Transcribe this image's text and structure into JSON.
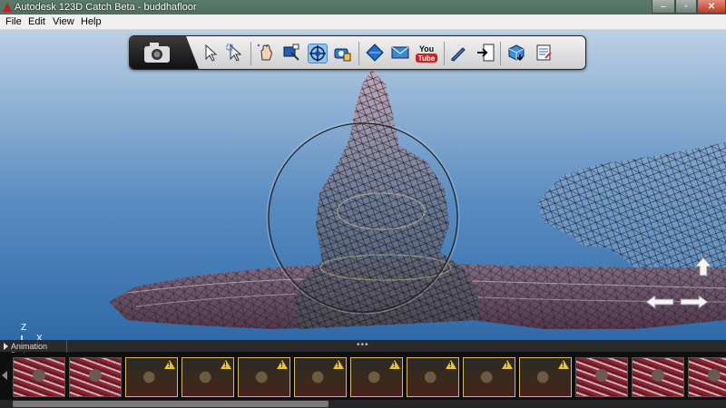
{
  "window": {
    "title": "Autodesk 123D Catch Beta - buddhafloor",
    "min_glyph": "–",
    "max_glyph": "▫",
    "close_glyph": "✕"
  },
  "menu": [
    "File",
    "Edit",
    "View",
    "Help"
  ],
  "toolbar": {
    "icons": [
      "camera-icon",
      "select-arrow-icon",
      "select-region-icon",
      "pan-hand-icon",
      "zoom-window-icon",
      "orbit-icon",
      "capture-camera-icon",
      "material-diamond-icon",
      "email-icon",
      "youtube-icon",
      "pen-icon",
      "export-icon",
      "mesh-download-icon",
      "notepad-icon"
    ],
    "youtube_label": "You Tube"
  },
  "axis": {
    "z_label": "Z",
    "x_label": "X"
  },
  "anim_panel": {
    "header_label": "Animation Path",
    "dots": "•••"
  },
  "thumbnails": [
    {
      "warning": false,
      "tone": "red"
    },
    {
      "warning": false,
      "tone": "red"
    },
    {
      "warning": true,
      "tone": "dark"
    },
    {
      "warning": true,
      "tone": "dark"
    },
    {
      "warning": true,
      "tone": "dark"
    },
    {
      "warning": true,
      "tone": "dark"
    },
    {
      "warning": true,
      "tone": "dark"
    },
    {
      "warning": true,
      "tone": "dark"
    },
    {
      "warning": true,
      "tone": "dark"
    },
    {
      "warning": true,
      "tone": "dark"
    },
    {
      "warning": false,
      "tone": "red"
    },
    {
      "warning": false,
      "tone": "red"
    },
    {
      "warning": false,
      "tone": "red"
    }
  ],
  "colors": {
    "accent_highlight": "#d8b860",
    "warning": "#f3c51b",
    "close": "#c33a20"
  }
}
